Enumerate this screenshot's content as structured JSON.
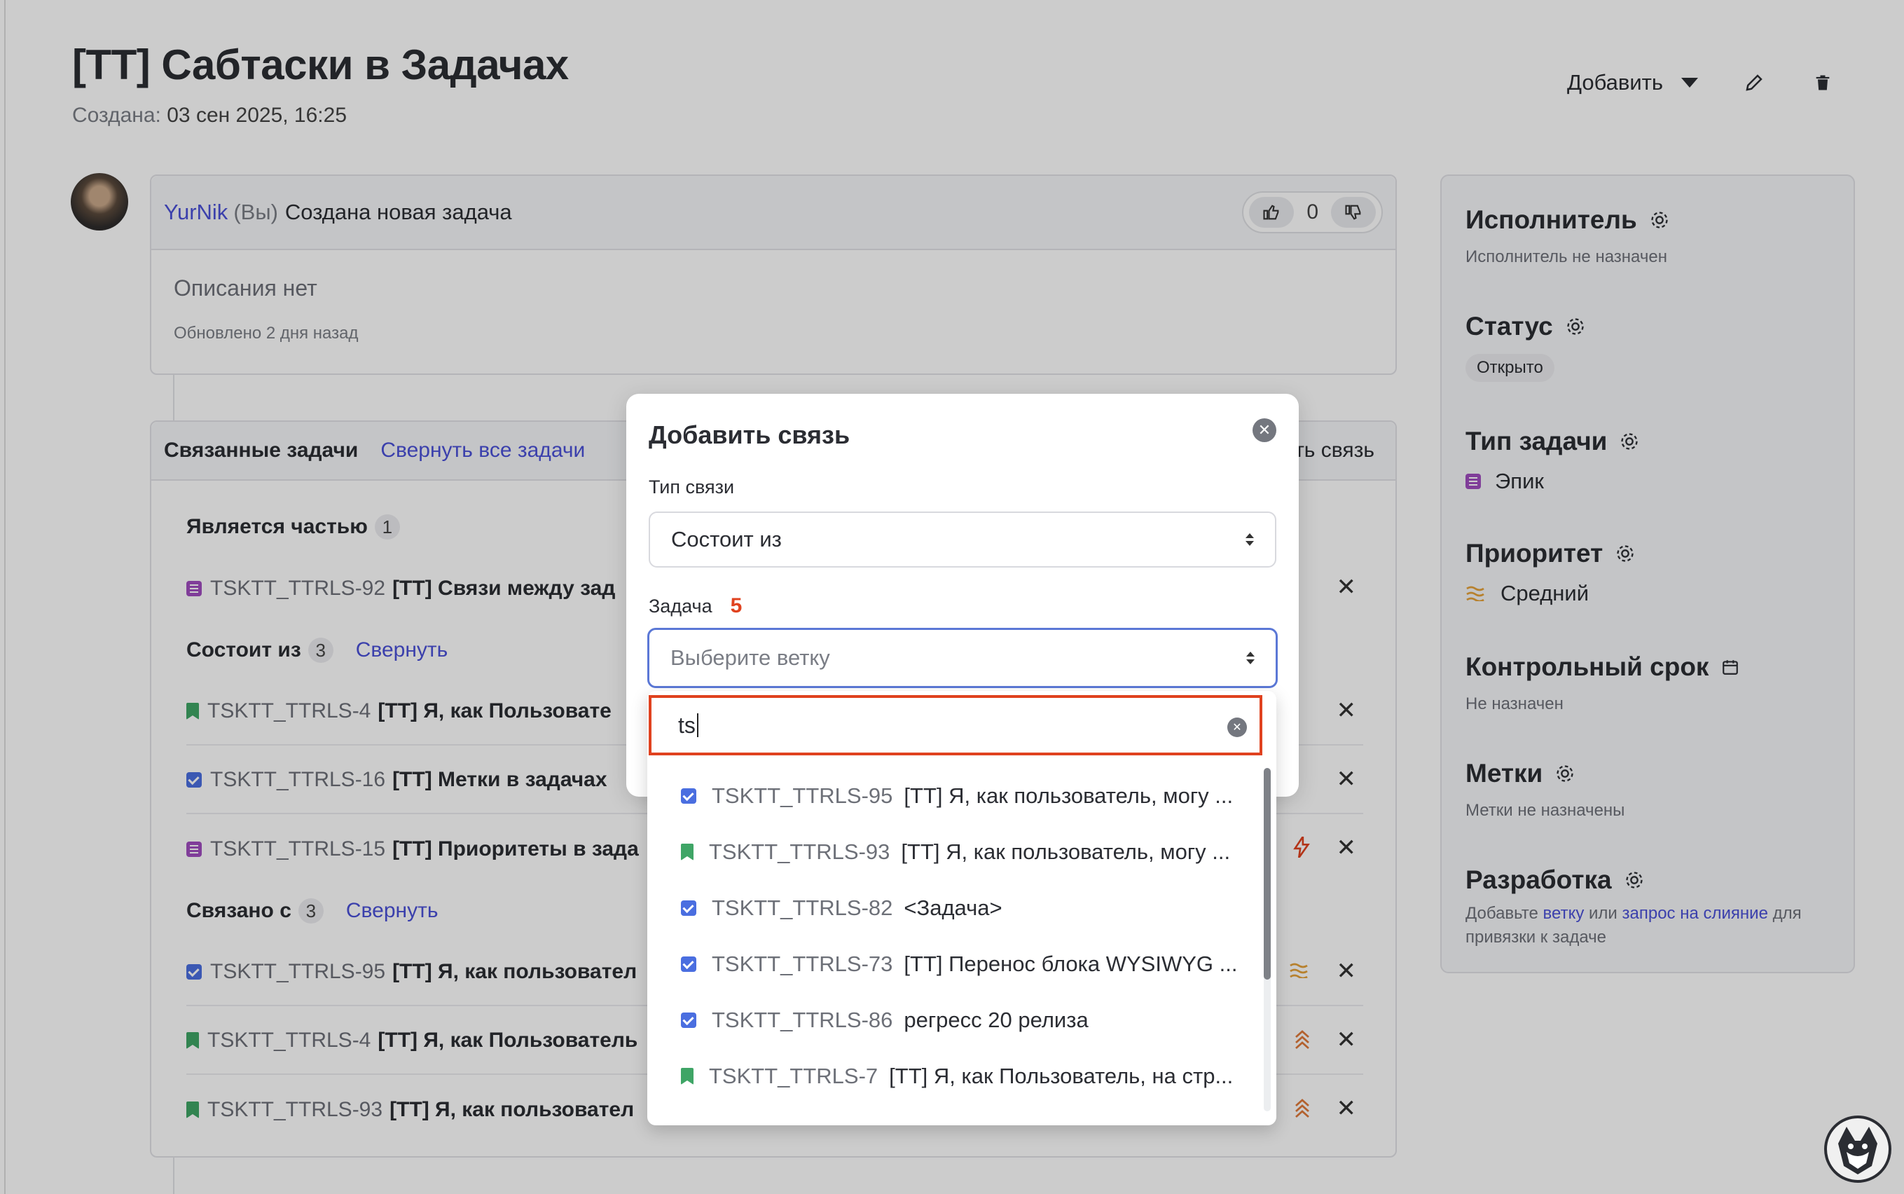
{
  "page": {
    "title": "[TT] Сабтаски в Задачах",
    "created_label": "Создана:",
    "created_value": "03 сен 2025, 16:25"
  },
  "header_actions": {
    "add_label": "Добавить",
    "edit_icon": "pencil-icon",
    "delete_icon": "trash-icon"
  },
  "activity": {
    "author": "YurNik",
    "you": "(Вы)",
    "text": "Создана новая задача",
    "votes": "0",
    "description": "Описания нет",
    "updated": "Обновлено 2 дня назад"
  },
  "related": {
    "title": "Связанные задачи",
    "collapse_all": "Свернуть все задачи",
    "add_link_partial": "ть связь",
    "groups": [
      {
        "label": "Является частью",
        "count": "1",
        "collapse": ""
      },
      {
        "label": "Состоит из",
        "count": "3",
        "collapse": "Свернуть"
      },
      {
        "label": "Связано с",
        "count": "3",
        "collapse": "Свернуть"
      }
    ],
    "rows": [
      {
        "type": "epic",
        "key": "TSKTT_TTRLS-92",
        "title": "[TT] Связи между зад"
      },
      {
        "type": "story",
        "key": "TSKTT_TTRLS-4",
        "title": "[TT] Я, как Пользовате"
      },
      {
        "type": "task",
        "key": "TSKTT_TTRLS-16",
        "title": "[TT] Метки в задачах"
      },
      {
        "type": "epic",
        "key": "TSKTT_TTRLS-15",
        "title": "[TT] Приоритеты в зада"
      },
      {
        "type": "task",
        "key": "TSKTT_TTRLS-95",
        "title": "[TT] Я, как пользовател"
      },
      {
        "type": "story",
        "key": "TSKTT_TTRLS-4",
        "title": "[TT] Я, как Пользователь"
      },
      {
        "type": "story",
        "key": "TSKTT_TTRLS-93",
        "title": "[TT] Я, как пользовател"
      }
    ]
  },
  "sidebar": {
    "assignee_label": "Исполнитель",
    "assignee_value": "Исполнитель не назначен",
    "status_label": "Статус",
    "status_value": "Открыто",
    "type_label": "Тип задачи",
    "type_value": "Эпик",
    "priority_label": "Приоритет",
    "priority_value": "Средний",
    "deadline_label": "Контрольный срок",
    "deadline_value": "Не назначен",
    "tags_label": "Метки",
    "tags_value": "Метки не назначены",
    "dev_label": "Разработка",
    "dev_text_1": "Добавьте",
    "dev_link_1": "ветку",
    "dev_text_2": "или",
    "dev_link_2": "запрос на слияние",
    "dev_text_3": "для привязки к задаче"
  },
  "modal": {
    "title": "Добавить связь",
    "link_type_label": "Тип связи",
    "link_type_value": "Состоит из",
    "task_label": "Задача",
    "task_annotation": "5",
    "task_placeholder": "Выберите ветку",
    "search_value": "ts",
    "options": [
      {
        "type": "task",
        "key": "TSKTT_TTRLS-95",
        "title": "[TT] Я, как пользователь, могу ..."
      },
      {
        "type": "story",
        "key": "TSKTT_TTRLS-93",
        "title": "[TT] Я, как пользователь, могу ..."
      },
      {
        "type": "task",
        "key": "TSKTT_TTRLS-82",
        "title": "<Задача>"
      },
      {
        "type": "task",
        "key": "TSKTT_TTRLS-73",
        "title": "[TT] Перенос блока WYSIWYG ..."
      },
      {
        "type": "task",
        "key": "TSKTT_TTRLS-86",
        "title": "регресс 20 релиза"
      },
      {
        "type": "story",
        "key": "TSKTT_TTRLS-7",
        "title": "[TT] Я, как Пользователь, на стр..."
      }
    ]
  }
}
